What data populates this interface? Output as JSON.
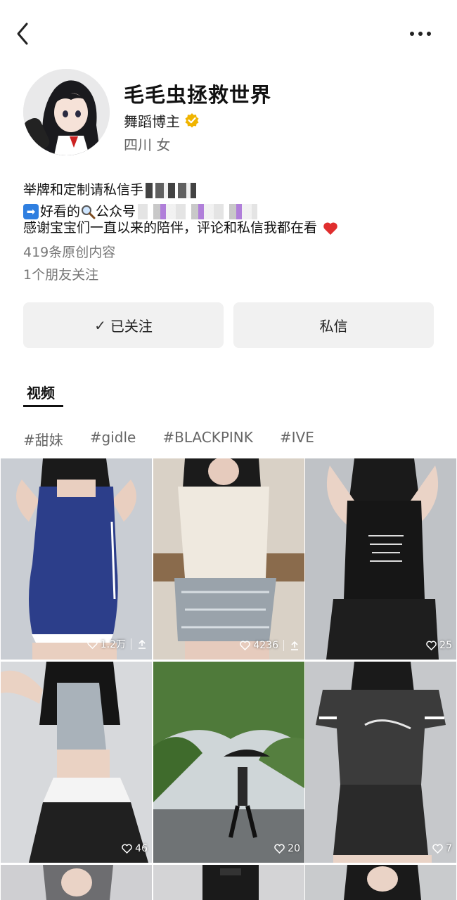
{
  "header": {
    "back_icon": "chevron-left-icon",
    "more_icon": "more-horizontal-icon"
  },
  "profile": {
    "name": "毛毛虫拯救世界",
    "role": "舞蹈博主",
    "verified_color": "#f0b400",
    "location": "四川 女",
    "bio_line1": "举牌和定制请私信",
    "bio_line1_tail": "手",
    "bio_line2": "好看的",
    "bio_line2_tail": "公众号",
    "bio_line3": "感谢宝宝们一直以来的陪伴，评论和私信我都在看",
    "posts_count": "419条原创内容",
    "friends_follow": "1个朋友关注"
  },
  "actions": {
    "follow_label": "已关注",
    "message_label": "私信"
  },
  "tabs": {
    "active": "视频"
  },
  "tags": [
    "#甜妹",
    "#gidle",
    "#BLACKPINK",
    "#IVE"
  ],
  "videos": [
    {
      "likes": "1.2万",
      "share": true
    },
    {
      "likes": "4236",
      "share": true
    },
    {
      "likes": "25",
      "share": false
    },
    {
      "likes": "46",
      "share": false
    },
    {
      "likes": "20",
      "share": false
    },
    {
      "likes": "7",
      "share": false
    }
  ],
  "colors": {
    "button_bg": "#f1f1f1",
    "heart_red": "#e02e2e",
    "tag_text": "#666666"
  }
}
